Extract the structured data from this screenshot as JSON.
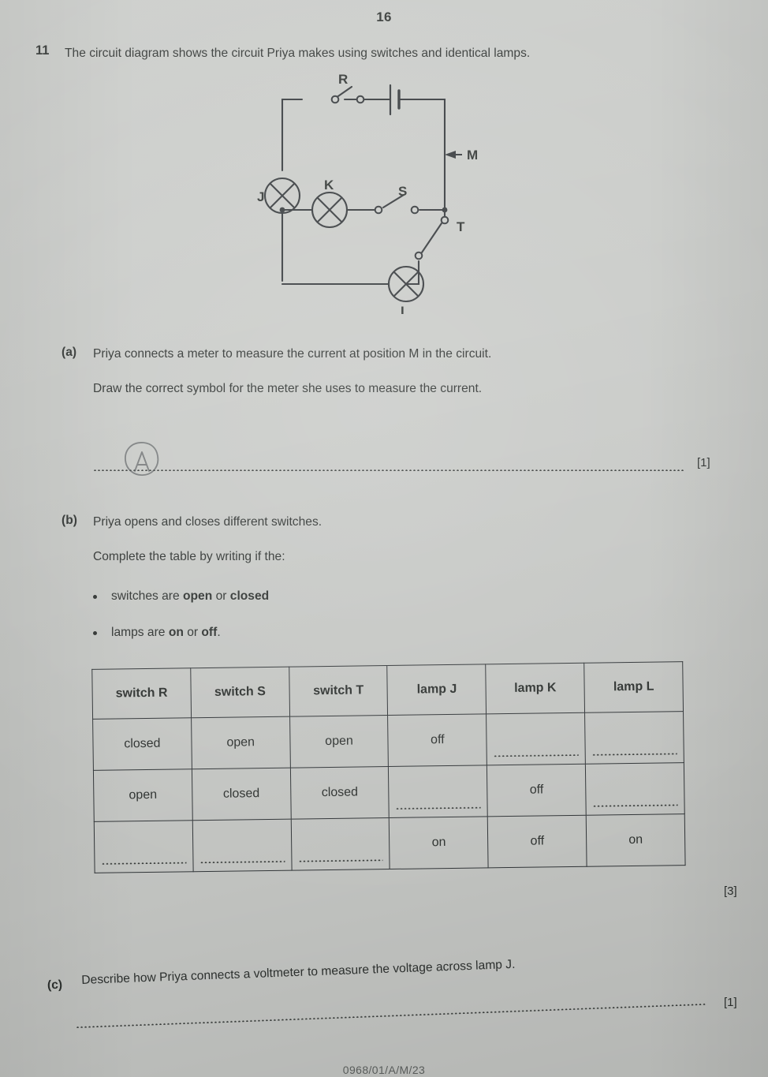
{
  "page": {
    "number": "16",
    "footer_code": "0968/01/A/M/23",
    "paper_color": "#c9cbc8",
    "ink_color": "#2f3331"
  },
  "question": {
    "number": "11",
    "stem": "The circuit diagram shows the circuit Priya makes using switches and identical lamps."
  },
  "circuit": {
    "lamps": [
      {
        "id": "lamp-j",
        "label": "J"
      },
      {
        "id": "lamp-k",
        "label": "K"
      },
      {
        "id": "lamp-l",
        "label": "L"
      }
    ],
    "switches": [
      {
        "id": "switch-r",
        "label": "R",
        "state": "open"
      },
      {
        "id": "switch-s",
        "label": "S",
        "state": "open"
      },
      {
        "id": "switch-t",
        "label": "T",
        "state": "open"
      }
    ],
    "cell": {
      "id": "cell",
      "label": ""
    },
    "position_marker": {
      "id": "position-m",
      "label": "M"
    }
  },
  "parts": {
    "a": {
      "label": "(a)",
      "line1": "Priya connects a meter to measure the current at position M in the circuit.",
      "line2": "Draw the correct symbol for the meter she uses to measure the current.",
      "answer_sketch": "A",
      "marks": "[1]"
    },
    "b": {
      "label": "(b)",
      "line1": "Priya opens and closes different switches.",
      "line2": "Complete the table by writing if the:",
      "bullet1_pre": "switches are ",
      "bullet1_b1": "open",
      "bullet1_mid": " or ",
      "bullet1_b2": "closed",
      "bullet2_pre": "lamps are ",
      "bullet2_b1": "on",
      "bullet2_mid": " or ",
      "bullet2_b2": "off",
      "bullet2_post": ".",
      "marks": "[3]",
      "table": {
        "headers": [
          "switch R",
          "switch S",
          "switch T",
          "lamp J",
          "lamp K",
          "lamp L"
        ],
        "rows": [
          [
            "closed",
            "open",
            "open",
            "off",
            "",
            ""
          ],
          [
            "open",
            "closed",
            "closed",
            "",
            "off",
            ""
          ],
          [
            "",
            "",
            "",
            "on",
            "off",
            "on"
          ]
        ]
      }
    },
    "c": {
      "label": "(c)",
      "line1": "Describe how Priya connects a voltmeter to measure the voltage across lamp J.",
      "marks": "[1]"
    }
  }
}
